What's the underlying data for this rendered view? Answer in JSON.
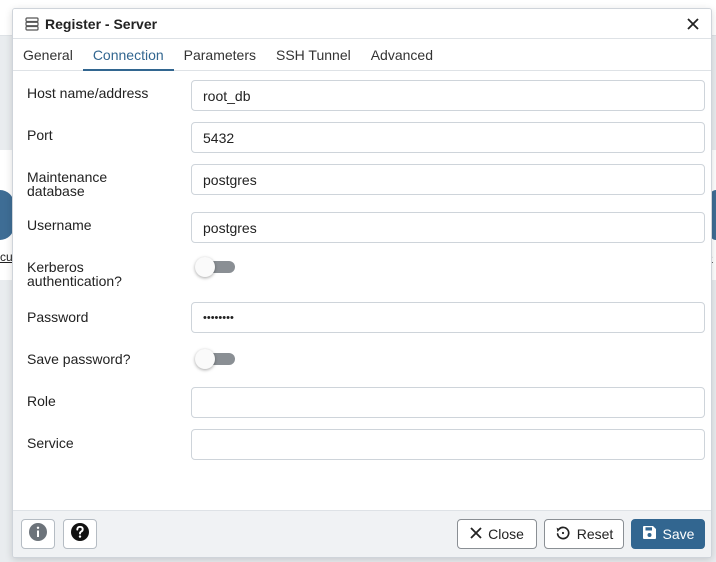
{
  "dialog": {
    "title": "Register - Server",
    "tabs": [
      {
        "label": "General"
      },
      {
        "label": "Connection"
      },
      {
        "label": "Parameters"
      },
      {
        "label": "SSH Tunnel"
      },
      {
        "label": "Advanced"
      }
    ],
    "active_tab": "Connection"
  },
  "form": {
    "host": {
      "label": "Host name/address",
      "value": "root_db"
    },
    "port": {
      "label": "Port",
      "value": "5432"
    },
    "maintenance_db": {
      "label_line1": "Maintenance",
      "label_line2": "database",
      "value": "postgres"
    },
    "username": {
      "label": "Username",
      "value": "postgres"
    },
    "kerberos": {
      "label_line1": "Kerberos",
      "label_line2": "authentication?",
      "on": false
    },
    "password": {
      "label": "Password",
      "value": "••••••••"
    },
    "save_password": {
      "label": "Save password?",
      "on": false
    },
    "role": {
      "label": "Role",
      "value": ""
    },
    "service": {
      "label": "Service",
      "value": ""
    }
  },
  "footer": {
    "close_label": "Close",
    "reset_label": "Reset",
    "save_label": "Save"
  },
  "background": {
    "left_link": "cu",
    "right_link": "e"
  },
  "colors": {
    "accent": "#326690",
    "toggle_off": "#8a8f94",
    "footer_bg": "#f0f2f4"
  },
  "icons": [
    "server-icon",
    "close-icon",
    "info-icon",
    "help-icon",
    "close-x-icon",
    "reset-icon",
    "save-disk-icon"
  ]
}
